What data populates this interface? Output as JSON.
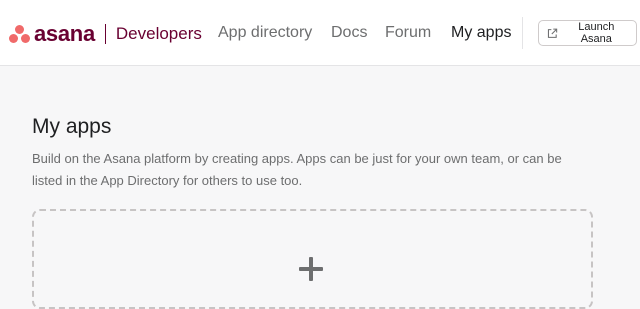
{
  "header": {
    "logo_text": "asana",
    "product_label": "Developers",
    "nav": {
      "app_directory": "App directory",
      "docs": "Docs",
      "forum": "Forum",
      "my_apps": "My apps"
    },
    "launch_button": {
      "label": "Launch Asana",
      "icon": "external-link-icon"
    }
  },
  "main": {
    "title": "My apps",
    "description": "Build on the Asana platform by creating apps. Apps can be just for your own team, or can be listed in the App Directory for others to use too.",
    "create_card": {
      "icon": "plus-icon"
    }
  },
  "colors": {
    "brand_coral": "#f06a6a",
    "brand_plum": "#690031",
    "text_primary": "#1e1f21",
    "text_secondary": "#6d6e6f",
    "page_background": "#f7f7f8"
  }
}
